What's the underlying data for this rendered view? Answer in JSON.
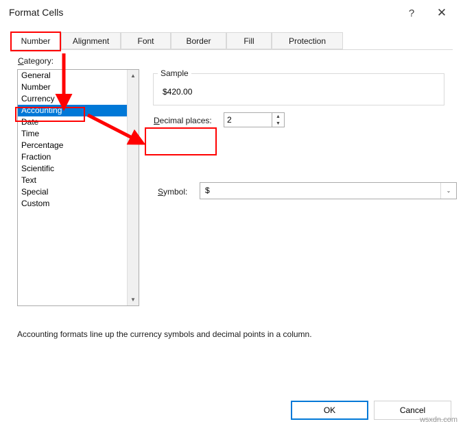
{
  "window": {
    "title": "Format Cells",
    "help_icon": "?",
    "close_icon": "✕"
  },
  "tabs": [
    {
      "label": "Number",
      "active": true
    },
    {
      "label": "Alignment",
      "active": false
    },
    {
      "label": "Font",
      "active": false
    },
    {
      "label": "Border",
      "active": false
    },
    {
      "label": "Fill",
      "active": false
    },
    {
      "label": "Protection",
      "active": false
    }
  ],
  "category": {
    "label": "Category:",
    "items": [
      "General",
      "Number",
      "Currency",
      "Accounting",
      "Date",
      "Time",
      "Percentage",
      "Fraction",
      "Scientific",
      "Text",
      "Special",
      "Custom"
    ],
    "selected": "Accounting",
    "scroll_up_icon": "▲",
    "scroll_down_icon": "▼"
  },
  "sample": {
    "group_title": "Sample",
    "value": "$420.00"
  },
  "decimal_places": {
    "label": "Decimal places:",
    "value": "2",
    "spin_up_icon": "▲",
    "spin_down_icon": "▼"
  },
  "symbol": {
    "label": "Symbol:",
    "value": "$",
    "dropdown_icon": "⌄"
  },
  "description": "Accounting formats line up the currency symbols and decimal points in a column.",
  "buttons": {
    "ok": "OK",
    "cancel": "Cancel"
  },
  "watermark": "wsxdn.com",
  "annotation_color": "#ff0000"
}
